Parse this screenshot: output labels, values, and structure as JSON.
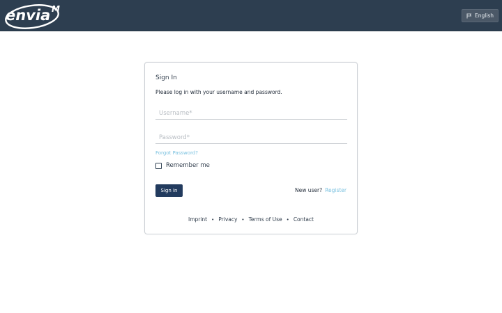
{
  "header": {
    "logo_text": "envia",
    "logo_superscript": "M",
    "language_label": "English"
  },
  "login": {
    "title": "Sign In",
    "subtitle": "Please log in with your username and password.",
    "username_placeholder": "Username*",
    "password_placeholder": "Password*",
    "forgot_password": "Forgot Password?",
    "remember_me": "Remember me",
    "sign_in_button": "Sign In",
    "new_user": "New user?",
    "register": "Register"
  },
  "footer": {
    "imprint": "Imprint",
    "privacy": "Privacy",
    "terms": "Terms of Use",
    "contact": "Contact",
    "separator": "•"
  },
  "colors": {
    "header_bg": "#2d3e50",
    "primary_button": "#223b5e",
    "link": "#7cc2e0"
  }
}
